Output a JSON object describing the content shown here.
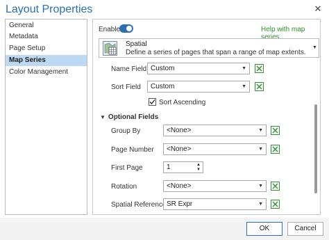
{
  "window": {
    "title": "Layout Properties",
    "close_glyph": "✕"
  },
  "nav": {
    "items": [
      {
        "label": "General",
        "selected": false
      },
      {
        "label": "Metadata",
        "selected": false
      },
      {
        "label": "Page Setup",
        "selected": false
      },
      {
        "label": "Map Series",
        "selected": true
      },
      {
        "label": "Color Management",
        "selected": false
      }
    ]
  },
  "panel": {
    "enable_label": "Enable",
    "enable_on": true,
    "help_link": "Help with map series",
    "series_type": {
      "name": "Spatial",
      "description": "Define a series of pages that span a range of map extents.",
      "icon": "spatial-grid-icon"
    },
    "name_field": {
      "label": "Name Field",
      "value": "Custom"
    },
    "sort_field": {
      "label": "Sort Field",
      "value": "Custom"
    },
    "sort_ascending": {
      "label": "Sort Ascending",
      "checked": true
    },
    "optional_section": "Optional Fields",
    "group_by": {
      "label": "Group By",
      "value": "<None>"
    },
    "page_number": {
      "label": "Page Number",
      "value": "<None>"
    },
    "first_page": {
      "label": "First Page",
      "value": "1"
    },
    "rotation": {
      "label": "Rotation",
      "value": "<None>"
    },
    "spatial_reference": {
      "label": "Spatial Reference",
      "value": "SR Expr"
    }
  },
  "footer": {
    "ok": "OK",
    "cancel": "Cancel"
  },
  "colors": {
    "accent": "#2a6fb4",
    "link": "#2f8f2f",
    "nav_selected": "#bcd8f2",
    "expression_icon": "#3c8a3c"
  }
}
